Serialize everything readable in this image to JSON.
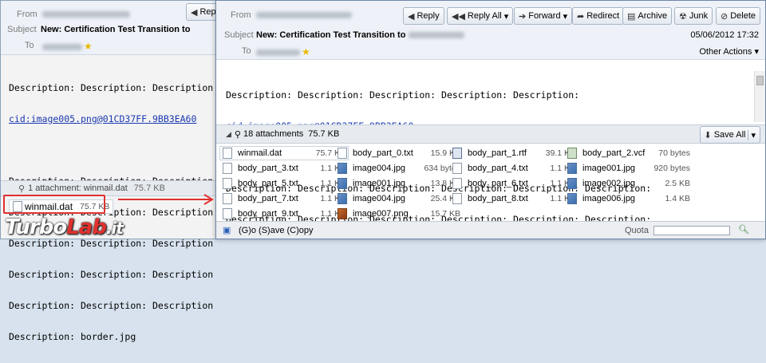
{
  "back": {
    "from_label": "From",
    "subject_label": "Subject",
    "to_label": "To",
    "subject": "New: Certification Test Transition to",
    "reply_btn": "Rep",
    "body_lines": [
      "Description: Description: Description",
      "cid:image005.png@01CD37FF.9BB3EA60",
      "",
      "Description: Description: Description",
      "Description: Description: Description",
      "Description: Description: Description",
      "Description: Description: Description",
      "Description: Description: Description",
      "Description: border.jpg"
    ],
    "attach_summary": "1 attachment: winmail.dat",
    "attach_summary_size": "75.7 KB",
    "attach_name": "winmail.dat",
    "attach_size": "75.7 KB"
  },
  "front": {
    "from_label": "From",
    "subject_label": "Subject",
    "to_label": "To",
    "subject": "New: Certification Test Transition to",
    "date": "05/06/2012 17:32",
    "other_actions": "Other Actions",
    "toolbar": [
      {
        "label": "Reply",
        "icon": "reply-icon",
        "glyph": "◀"
      },
      {
        "label": "Reply All",
        "icon": "reply-all-icon",
        "glyph": "◀◀"
      },
      {
        "label": "Forward",
        "icon": "forward-icon",
        "glyph": "➔"
      },
      {
        "label": "Redirect",
        "icon": "redirect-icon",
        "glyph": "➦"
      },
      {
        "label": "Archive",
        "icon": "archive-icon",
        "glyph": "▤"
      },
      {
        "label": "Junk",
        "icon": "junk-icon",
        "glyph": "☢"
      },
      {
        "label": "Delete",
        "icon": "delete-icon",
        "glyph": "⊘"
      }
    ],
    "body_line1": "Description: Description: Description: Description: Description:",
    "body_link": "cid:image005.png@01CD37FF.9BB3EA60",
    "body_line3": "Description: Description: Description: Description: Description: Description:",
    "body_line4": "Description: Description: Description: Description: Description: Description:",
    "attachments_count": "18 attachments",
    "attachments_size": "75.7 KB",
    "save_all": "Save All",
    "attachments": [
      {
        "name": "winmail.dat",
        "size": "75.7 KB",
        "type": "dat"
      },
      {
        "name": "body_part_0.txt",
        "size": "15.9 KB",
        "type": "txt"
      },
      {
        "name": "body_part_1.rtf",
        "size": "39.1 KB",
        "type": "rtf"
      },
      {
        "name": "body_part_2.vcf",
        "size": "70 bytes",
        "type": "vcf"
      },
      {
        "name": "body_part_3.txt",
        "size": "1.1 KB",
        "type": "txt"
      },
      {
        "name": "image004.jpg",
        "size": "634 bytes",
        "type": "img"
      },
      {
        "name": "body_part_4.txt",
        "size": "1.1 KB",
        "type": "txt"
      },
      {
        "name": "image001.jpg",
        "size": "920 bytes",
        "type": "img"
      },
      {
        "name": "body_part_5.txt",
        "size": "1.1 KB",
        "type": "txt"
      },
      {
        "name": "image001.jpg",
        "size": "13.8 KB",
        "type": "img"
      },
      {
        "name": "body_part_6.txt",
        "size": "1.1 KB",
        "type": "txt"
      },
      {
        "name": "image002.jpg",
        "size": "2.5 KB",
        "type": "img"
      },
      {
        "name": "body_part_7.txt",
        "size": "1.1 KB",
        "type": "txt"
      },
      {
        "name": "image004.jpg",
        "size": "25.4 KB",
        "type": "img"
      },
      {
        "name": "body_part_8.txt",
        "size": "1.1 KB",
        "type": "txt"
      },
      {
        "name": "image006.jpg",
        "size": "1.4 KB",
        "type": "img"
      },
      {
        "name": "body_part_9.txt",
        "size": "1.1 KB",
        "type": "txt"
      },
      {
        "name": "image007.png",
        "size": "15.7 KB",
        "type": "png"
      }
    ],
    "status_text": "(G)o (S)ave (C)opy",
    "quota_label": "Quota"
  },
  "watermark": {
    "part1": "Turbo",
    "part2": "Lab",
    "part3": ".it"
  },
  "colors": {
    "accent_red": "#e0312e",
    "link_blue": "#1a38b0",
    "toolbar_bg": "#eef2f8"
  }
}
